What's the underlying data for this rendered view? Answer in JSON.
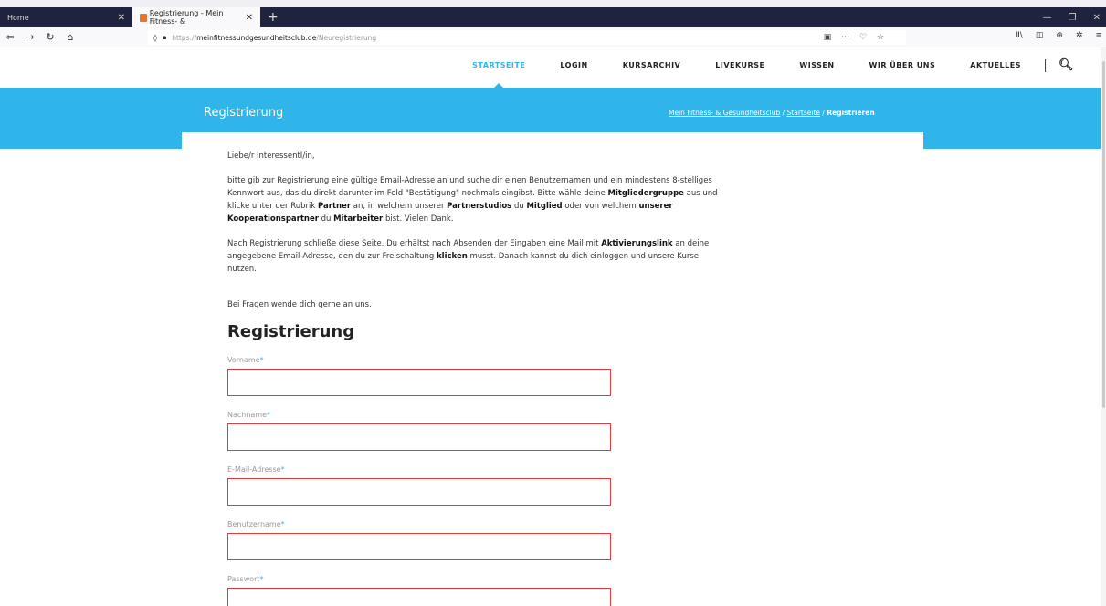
{
  "browser": {
    "tabs": [
      {
        "label": "Home",
        "active": false
      },
      {
        "label": "Registrierung - Mein Fitness- &",
        "active": true
      }
    ],
    "new_tab": "+",
    "url_prefix": "https://",
    "url_host": "meinfitnessundgesundheitsclub.de",
    "url_path": "/Neuregistrierung"
  },
  "site": {
    "menu": [
      "STARTSEITE",
      "LOGIN",
      "KURSARCHIV",
      "LIVEKURSE",
      "WISSEN",
      "WIR ÜBER UNS",
      "AKTUELLES"
    ],
    "banner_title": "Registrierung",
    "breadcrumb": {
      "home": "Mein Fitness- & Gesundheitsclub",
      "sep": "/",
      "start": "Startseite",
      "current": "Registrieren"
    }
  },
  "content": {
    "greeting": "Liebe/r InteressentI/in,",
    "para1": [
      "bitte gib zur Registrierung eine gültige Email-Adresse an und suche dir einen Benutzernamen und ein mindestens 8-stelliges Kennwort aus, das du direkt darunter im Feld \"Bestätigung\" nochmals eingibst. Bitte wähle deine ",
      "Mitgliedergruppe",
      " aus und klicke unter der Rubrik ",
      "Partner",
      " an, in welchem unserer ",
      "Partnerstudios",
      " du ",
      "Mitglied",
      " oder von welchem ",
      "unserer Kooperationspartner",
      " du ",
      "Mitarbeiter",
      " bist.  Vielen Dank."
    ],
    "para2": [
      "Nach Registrierung schließe diese Seite. Du erhältst nach Absenden der Eingaben eine Mail mit ",
      "Aktivierungslink",
      " an deine angegebene Email-Adresse, den du zur Freischaltung ",
      "klicken",
      " musst. Danach kannst du dich einloggen und unsere Kurse nutzen."
    ],
    "questions": "Bei Fragen wende dich gerne an uns.",
    "form_title": "Registrierung",
    "required_mark": "*",
    "fields": [
      {
        "label": "Vorname",
        "value": ""
      },
      {
        "label": "Nachname",
        "value": ""
      },
      {
        "label": "E-Mail-Adresse",
        "value": ""
      },
      {
        "label": "Benutzername",
        "value": ""
      },
      {
        "label": "Passwort",
        "value": ""
      }
    ]
  }
}
